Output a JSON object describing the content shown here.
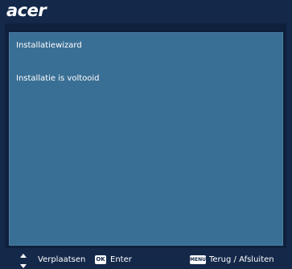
{
  "brand": {
    "logo_text": "acer"
  },
  "panel": {
    "title": "Installatiewizard",
    "message": "Installatie is voltooid"
  },
  "footer": {
    "navigate_icon": "up-down-arrows-icon",
    "navigate_label": "Verplaatsen",
    "ok_key": "OK",
    "ok_label": "Enter",
    "menu_key": "MENU",
    "menu_label": "Terug / Afsluiten"
  },
  "colors": {
    "background": "#14284a",
    "panel": "#3a6f95",
    "text": "#ffffff"
  }
}
